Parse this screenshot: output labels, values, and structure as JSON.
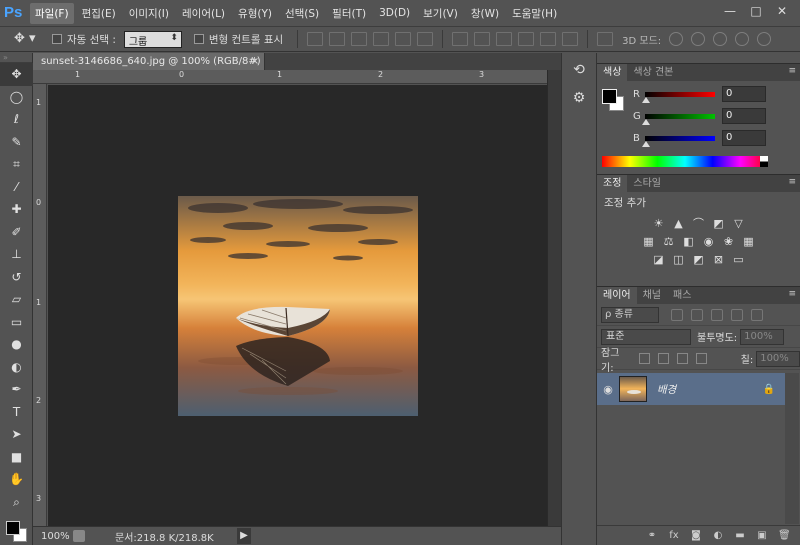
{
  "app": {
    "logo": "Ps"
  },
  "menu": [
    "파일(F)",
    "편집(E)",
    "이미지(I)",
    "레이어(L)",
    "유형(Y)",
    "선택(S)",
    "필터(T)",
    "3D(D)",
    "보기(V)",
    "창(W)",
    "도움말(H)"
  ],
  "window_controls": {
    "minimize": "—",
    "maximize": "□",
    "close": "✕"
  },
  "options": {
    "tool_icon": "move-tool-icon",
    "auto_select_label": "자동 선택 :",
    "auto_select_value": "그룹",
    "transform_label": "변형 컨트롤 표시",
    "mode3d_label": "3D 모드:"
  },
  "document": {
    "tab_title": "sunset-3146686_640.jpg @ 100% (RGB/8#) *",
    "close_glyph": "×",
    "ruler_top": [
      "1",
      "0",
      "1",
      "2",
      "3"
    ],
    "ruler_left": [
      "1",
      "0",
      "1",
      "2",
      "3"
    ]
  },
  "status": {
    "zoom": "100%",
    "doc_size": "문서:218.8 K/218.8K",
    "arrow": "▶"
  },
  "tools": [
    "move",
    "marquee",
    "lasso",
    "quick-select",
    "crop",
    "eyedropper",
    "healing",
    "brush",
    "stamp",
    "history-brush",
    "eraser",
    "gradient",
    "blur",
    "dodge",
    "pen",
    "type",
    "path-select",
    "shape",
    "hand",
    "zoom"
  ],
  "color_panel": {
    "tabs": [
      "색상",
      "색상 견본"
    ],
    "channels": [
      {
        "label": "R",
        "value": "0",
        "color": "#ff0000"
      },
      {
        "label": "G",
        "value": "0",
        "color": "#00c000"
      },
      {
        "label": "B",
        "value": "0",
        "color": "#0000ff"
      }
    ]
  },
  "adjust_panel": {
    "tabs": [
      "조정",
      "스타일"
    ],
    "title": "조정 추가"
  },
  "layers_panel": {
    "tabs": [
      "레이어",
      "채널",
      "패스"
    ],
    "filter_label": "ρ 종류",
    "blend_mode": "표준",
    "opacity_label": "불투명도:",
    "opacity_value": "100%",
    "lock_label": "잠그기:",
    "fill_label": "칠:",
    "fill_value": "100%",
    "layer_name": "배경"
  }
}
